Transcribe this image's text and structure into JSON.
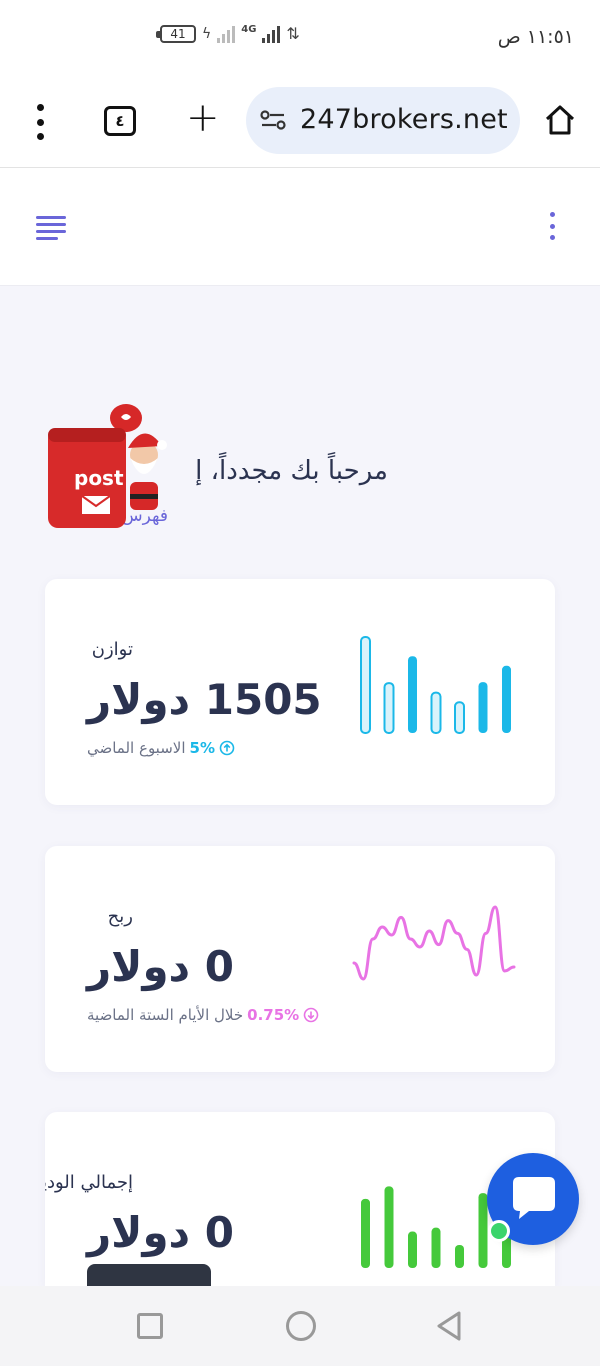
{
  "status": {
    "time": "١١:٥١ ص",
    "battery": "41",
    "network": "4G"
  },
  "browser": {
    "tab_count": "٤",
    "url": "247brokers.net",
    "icons": [
      "more-vert-icon",
      "tabs-icon",
      "plus-icon",
      "site-settings-icon",
      "home-icon"
    ]
  },
  "header": {
    "icons": [
      "hamburger-menu-icon",
      "more-vert-icon"
    ]
  },
  "welcome": {
    "title": "مرحباً بك مجدداً، إ",
    "link": "فهرس"
  },
  "cards": {
    "balance": {
      "label": "توازن",
      "value": "1505 دولار",
      "change": "5%",
      "change_text": "الاسبوع الماضي",
      "change_dir": "up",
      "accent": "#1bb8e8",
      "bars": [
        1.0,
        0.52,
        0.8,
        0.42,
        0.32,
        0.53,
        0.7
      ],
      "bar_outline": [
        true,
        true,
        false,
        true,
        true,
        false,
        false
      ]
    },
    "profit": {
      "label": "ربح",
      "value": "0 دولار",
      "change": "0.75%",
      "change_text": "خلال الأيام الستة الماضية",
      "change_dir": "down",
      "accent": "#e873e4",
      "line": [
        0.25,
        0.05,
        0.55,
        0.7,
        0.6,
        0.82,
        0.55,
        0.45,
        0.65,
        0.48,
        0.78,
        0.62,
        0.42,
        0.1,
        0.62,
        0.95,
        0.15,
        0.2
      ]
    },
    "deposit": {
      "label": "إجمالي الوديعة",
      "value": "0 دولار",
      "accent": "#45c93b",
      "bars": [
        0.72,
        0.85,
        0.38,
        0.42,
        0.24,
        0.78,
        0.62
      ]
    }
  },
  "nav": {
    "icons": [
      "recent-apps-icon",
      "home-circle-icon",
      "back-triangle-icon"
    ]
  }
}
